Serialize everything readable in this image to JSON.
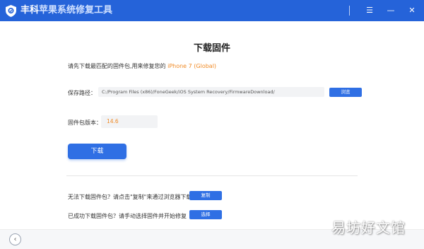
{
  "window": {
    "brand": "丰科",
    "title_rest": "苹果系统修复工具",
    "icons": [
      "shield-logo-icon",
      "menu-icon",
      "minimize-icon",
      "close-icon"
    ]
  },
  "main": {
    "heading": "下载固件",
    "notice_text": "请先下载最匹配的固件包,用来修复您的 ",
    "device": "iPhone 7 (Global)",
    "path_label": "保存路径：",
    "path_value": "C:/Program Files (x86)/FoneGeek/iOS System Recovery/FirmwareDownload/",
    "browse_label": "浏览",
    "version_label": "固件包版本：",
    "version_value": "14.6",
    "download_label": "下载"
  },
  "help": {
    "line1": "无法下载固件包？请点击\"复制\"来通过浏览器下载",
    "copy_label": "复制",
    "line2": "已成功下载固件包？请手动选择固件并开始修复",
    "select_label": "选择"
  },
  "footer": {
    "back_icon": "‹",
    "watermark": "易坊好文馆"
  },
  "colors": {
    "titlebar": "#2563d9",
    "accent": "#2f6fe4",
    "highlight": "#f08a24"
  }
}
